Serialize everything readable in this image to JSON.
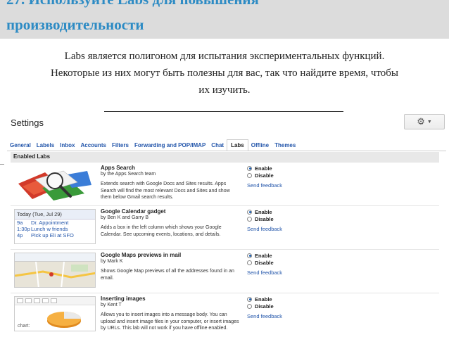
{
  "header": {
    "title_line1": "27. Используйте Labs для повышения",
    "title_line2": "производительности"
  },
  "intro": {
    "line1": "Labs является полигоном для испытания экспериментальных функций.",
    "line2": "Некоторые из них могут быть полезны для вас, так что найдите время, чтобы",
    "line3": "их изучить."
  },
  "gmail": {
    "settings_title": "Settings",
    "gear_icon": "gear-icon",
    "tabs": [
      {
        "label": "General"
      },
      {
        "label": "Labels"
      },
      {
        "label": "Inbox"
      },
      {
        "label": "Accounts"
      },
      {
        "label": "Filters"
      },
      {
        "label": "Forwarding and POP/IMAP"
      },
      {
        "label": "Chat"
      },
      {
        "label": "Labs",
        "active": true
      },
      {
        "label": "Offline"
      },
      {
        "label": "Themes"
      }
    ],
    "enabled_labs_header": "Enabled Labs",
    "enable_label": "Enable",
    "disable_label": "Disable",
    "send_feedback_label": "Send feedback",
    "labs": [
      {
        "title": "Apps Search",
        "author": "by the Apps Search team",
        "description": "Extends search with Google Docs and Sites results. Apps Search will find the most relevant Docs and Sites and show them below Gmail search results.",
        "enabled": true
      },
      {
        "title": "Google Calendar gadget",
        "author": "by Ben K and Garry B",
        "description": "Adds a box in the left column which shows your Google Calendar. See upcoming events, locations, and details.",
        "enabled": true,
        "thumb": {
          "date": "Today (Tue, Jul 29)",
          "events": [
            {
              "time": "9a",
              "text": "Dr. Appointment"
            },
            {
              "time": "1:30p",
              "text": "Lunch w friends"
            },
            {
              "time": "4p",
              "text": "Pick up Eli at SFO"
            }
          ]
        }
      },
      {
        "title": "Google Maps previews in mail",
        "author": "by Mark K",
        "description": "Shows Google Map previews of all the addresses found in an email.",
        "enabled": true
      },
      {
        "title": "Inserting images",
        "author": "by Kent T",
        "description": "Allows you to insert images into a message body. You can upload and insert image files in your computer, or insert images by URLs. This lab will not work if you have offline enabled.",
        "enabled": true,
        "thumb": {
          "chart_label": "chart:"
        }
      }
    ],
    "colors": {
      "header_bg": "#dcdcdc",
      "title_blue": "#2d8bc4",
      "link_blue": "#2255aa"
    }
  }
}
